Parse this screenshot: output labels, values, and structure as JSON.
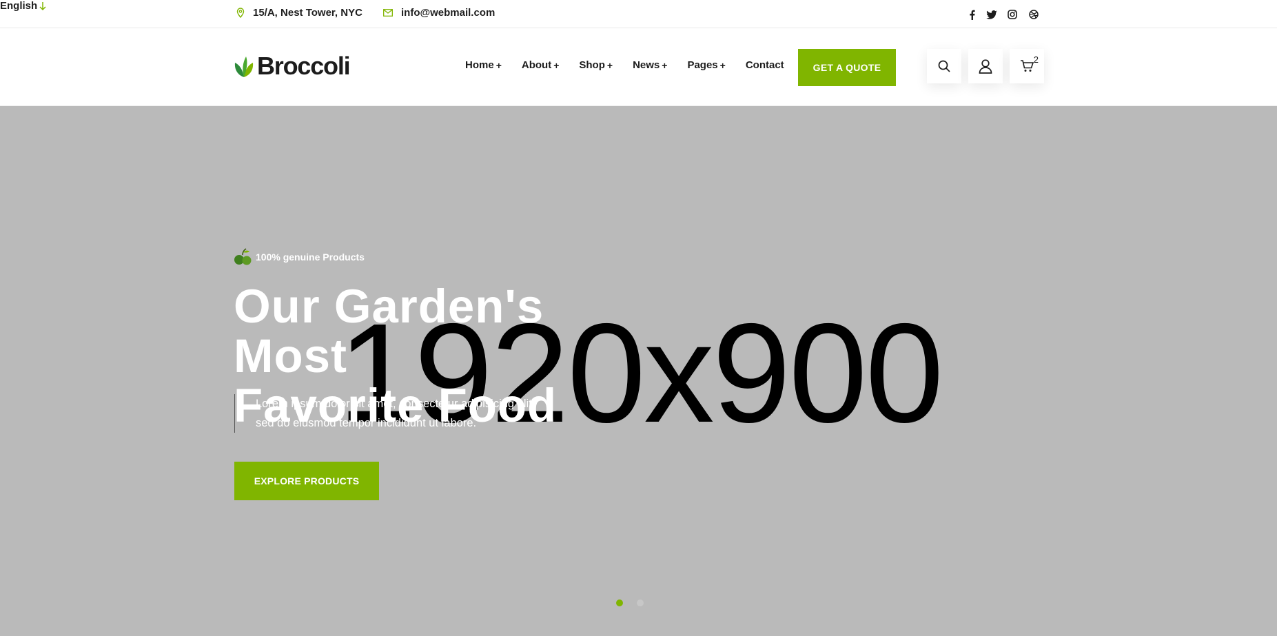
{
  "topbar": {
    "address": "15/A, Nest Tower, NYC",
    "email": "info@webmail.com",
    "language": "English",
    "social_icons": [
      "facebook-icon",
      "twitter-icon",
      "instagram-icon",
      "dribbble-icon"
    ]
  },
  "header": {
    "logo_text": "Broccoli",
    "nav": [
      {
        "label": "Home",
        "has_submenu": true
      },
      {
        "label": "About",
        "has_submenu": true
      },
      {
        "label": "Shop",
        "has_submenu": true
      },
      {
        "label": "News",
        "has_submenu": true
      },
      {
        "label": "Pages",
        "has_submenu": true
      },
      {
        "label": "Contact",
        "has_submenu": false
      }
    ],
    "plus": "+",
    "quote_button": "GET A QUOTE",
    "cart_count": "2"
  },
  "hero": {
    "placeholder": "1920x900",
    "tag": "100% genuine Products",
    "title_line1": "Our Garden's Most",
    "title_line2": "Favorite Food",
    "desc_line1": "Lorem ipsum dolor sit amet, consectetur adipisicing elit,",
    "desc_line2": "sed do eiusmod tempor incididunt ut labore.",
    "button": "EXPLORE PRODUCTS",
    "slides": 2,
    "active_slide": 1
  },
  "colors": {
    "accent": "#80b500",
    "hero_bg": "#bababa",
    "text_dark": "#1c1c1c"
  }
}
